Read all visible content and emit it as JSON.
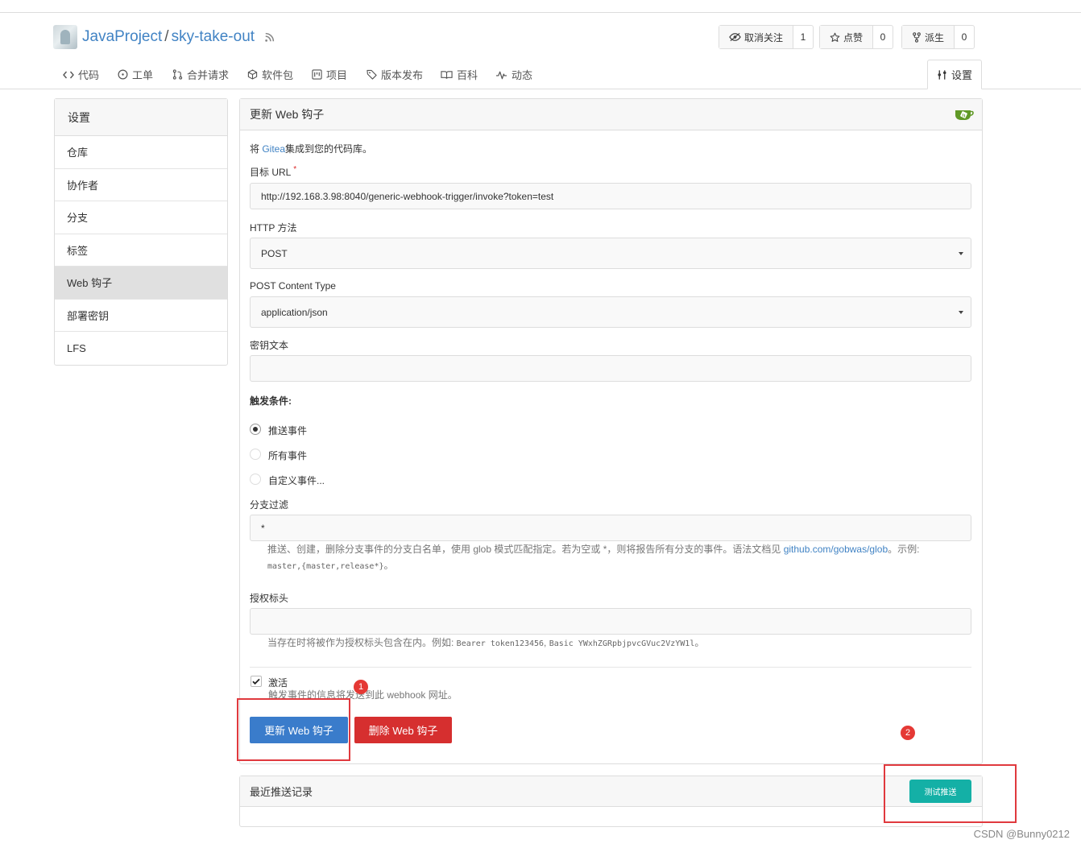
{
  "repo": {
    "owner": "JavaProject",
    "separator": "/",
    "name": "sky-take-out"
  },
  "actions": {
    "unwatch": {
      "label": "取消关注",
      "count": "1"
    },
    "star": {
      "label": "点赞",
      "count": "0"
    },
    "fork": {
      "label": "派生",
      "count": "0"
    }
  },
  "tabs": [
    {
      "label": "代码",
      "icon": "code-icon"
    },
    {
      "label": "工单",
      "icon": "issue-icon"
    },
    {
      "label": "合并请求",
      "icon": "pull-request-icon"
    },
    {
      "label": "软件包",
      "icon": "package-icon"
    },
    {
      "label": "项目",
      "icon": "project-icon"
    },
    {
      "label": "版本发布",
      "icon": "tag-icon"
    },
    {
      "label": "百科",
      "icon": "book-icon"
    },
    {
      "label": "动态",
      "icon": "pulse-icon"
    }
  ],
  "settings_tab": {
    "label": "设置",
    "icon": "tools-icon"
  },
  "sidebar": {
    "title": "设置",
    "items": [
      {
        "label": "仓库"
      },
      {
        "label": "协作者"
      },
      {
        "label": "分支"
      },
      {
        "label": "标签"
      },
      {
        "label": "Web 钩子",
        "active": true
      },
      {
        "label": "部署密钥"
      },
      {
        "label": "LFS"
      }
    ]
  },
  "form": {
    "header": "更新 Web 钩子",
    "intro_prefix": "将 ",
    "intro_link": "Gitea",
    "intro_suffix": "集成到您的代码库。",
    "target_url_label": "目标 URL",
    "required_mark": "*",
    "target_url_value": "http://192.168.3.98:8040/generic-webhook-trigger/invoke?token=test",
    "http_method_label": "HTTP 方法",
    "http_method_value": "POST",
    "content_type_label": "POST Content Type",
    "content_type_value": "application/json",
    "secret_label": "密钥文本",
    "secret_value": "",
    "trigger_label": "触发条件:",
    "trigger_options": [
      {
        "label": "推送事件",
        "selected": true
      },
      {
        "label": "所有事件",
        "selected": false
      },
      {
        "label": "自定义事件...",
        "selected": false
      }
    ],
    "branch_filter_label": "分支过滤",
    "branch_filter_value": "*",
    "branch_help_text": "推送、创建，删除分支事件的分支白名单，使用 glob 模式匹配指定。若为空或 *，则将报告所有分支的事件。语法文档见 ",
    "branch_help_link": "github.com/gobwas/glob",
    "branch_help_suffix": "。示例:",
    "branch_help_example": "master,{master,release*}",
    "branch_help_end": "。",
    "auth_header_label": "授权标头",
    "auth_header_value": "",
    "auth_help_text": "当存在时将被作为授权标头包含在内。例如: ",
    "auth_help_example1": "Bearer token123456",
    "auth_help_sep": ", ",
    "auth_help_example2": "Basic YWxhZGRpbjpvcGVuc2VzYW1l",
    "auth_help_end": "。",
    "active_label": "激活",
    "active_checked": true,
    "active_help": "触发事件的信息将发送到此 webhook 网址。",
    "update_button": "更新 Web 钩子",
    "delete_button": "删除 Web 钩子"
  },
  "recent": {
    "title": "最近推送记录",
    "test_button": "测试推送"
  },
  "annotations": {
    "marker1": "1",
    "marker2": "2"
  },
  "watermark": "CSDN @Bunny0212",
  "colors": {
    "link": "#4183c4",
    "primary": "#3a7ccb",
    "danger": "#d62f2f",
    "teal": "#14b0a6",
    "annotation": "#e0393e"
  }
}
